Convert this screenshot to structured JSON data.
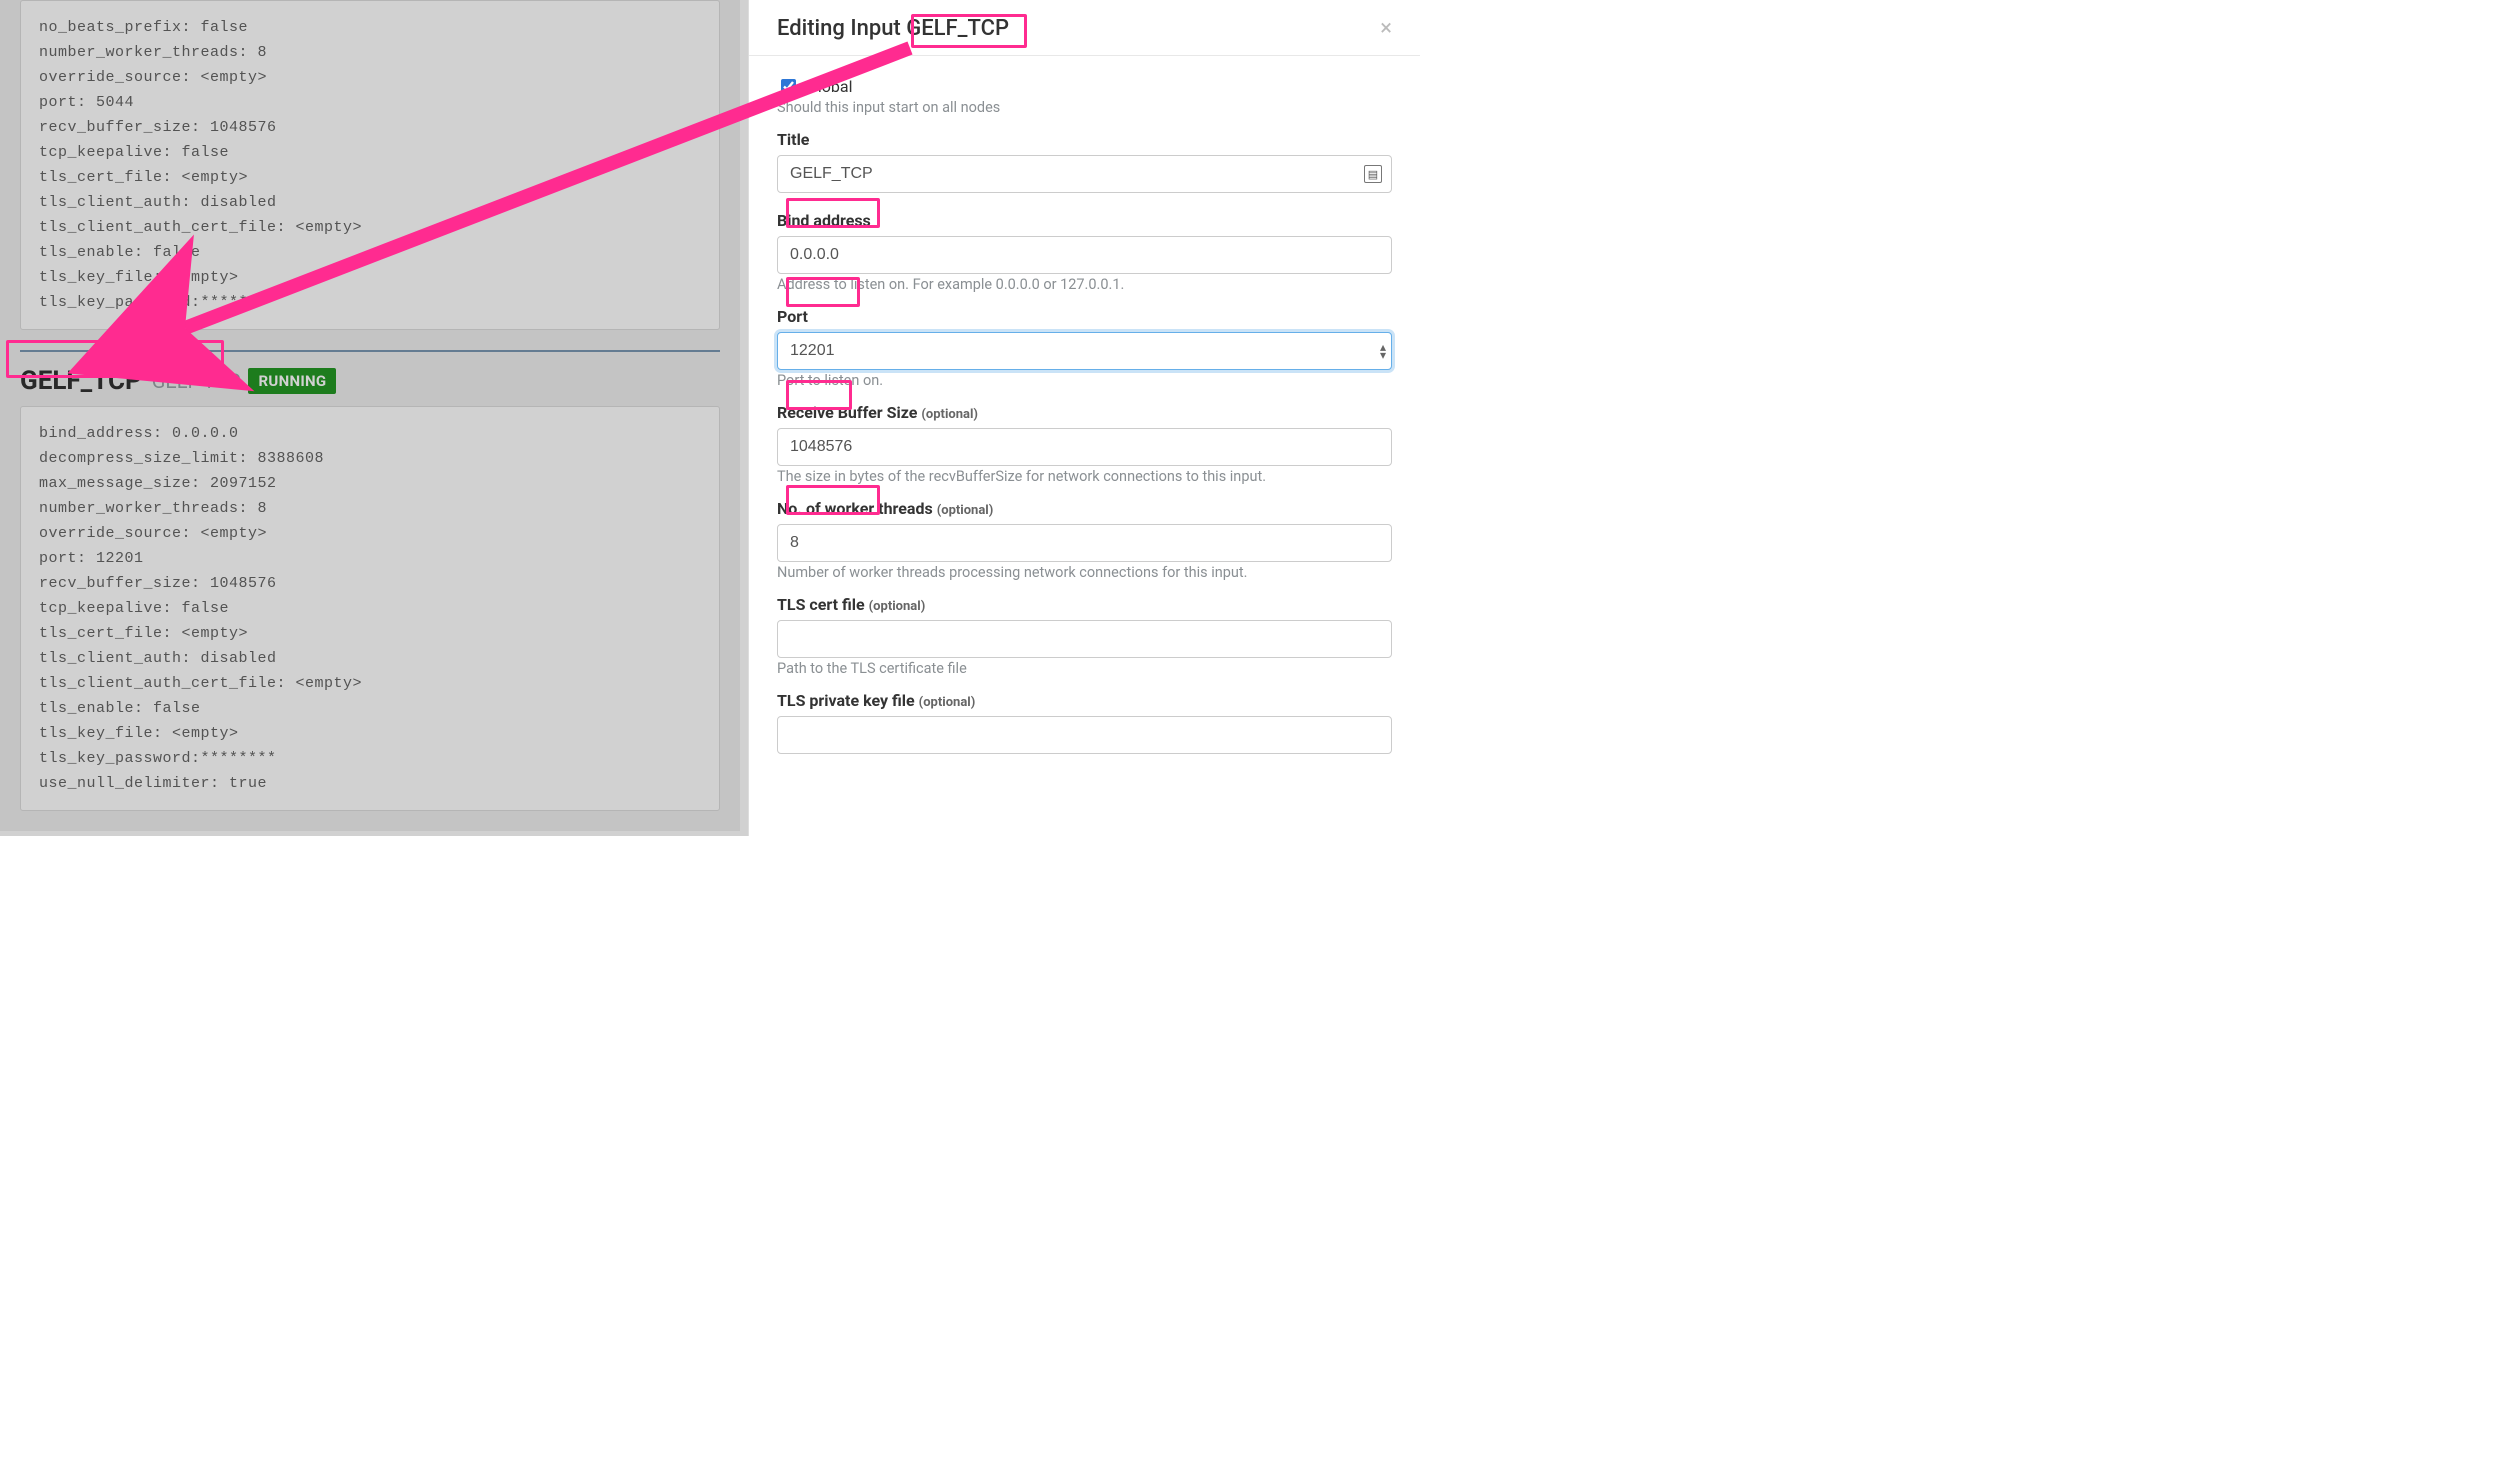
{
  "left": {
    "config_box_top": [
      "no_beats_prefix: false",
      "number_worker_threads: 8",
      "override_source: <empty>",
      "port: 5044",
      "recv_buffer_size: 1048576",
      "tcp_keepalive: false",
      "tls_cert_file: <empty>",
      "tls_client_auth: disabled",
      "tls_client_auth_cert_file: <empty>",
      "tls_enable: false",
      "tls_key_file: <empty>",
      "tls_key_password:********"
    ],
    "gelf": {
      "title": "GELF_TCP",
      "subtitle": "GELF TCP",
      "status": "RUNNING"
    },
    "config_box_bottom": [
      "bind_address: 0.0.0.0",
      "decompress_size_limit: 8388608",
      "max_message_size: 2097152",
      "number_worker_threads: 8",
      "override_source: <empty>",
      "port: 12201",
      "recv_buffer_size: 1048576",
      "tcp_keepalive: false",
      "tls_cert_file: <empty>",
      "tls_client_auth: disabled",
      "tls_client_auth_cert_file: <empty>",
      "tls_enable: false",
      "tls_key_file: <empty>",
      "tls_key_password:********",
      "use_null_delimiter: true"
    ]
  },
  "modal": {
    "title_prefix": "Editing Input ",
    "title_name": "GELF_TCP",
    "global_checked": true,
    "global_label": "Global",
    "global_help": "Should this input start on all nodes",
    "fields": {
      "title": {
        "label": "Title",
        "value": "GELF_TCP"
      },
      "bind_address": {
        "label": "Bind address",
        "value": "0.0.0.0",
        "help": "Address to listen on. For example 0.0.0.0 or 127.0.0.1."
      },
      "port": {
        "label": "Port",
        "value": "12201",
        "help": "Port to listen on."
      },
      "recv_buffer": {
        "label": "Receive Buffer Size",
        "optional": "(optional)",
        "value": "1048576",
        "help": "The size in bytes of the recvBufferSize for network connections to this input."
      },
      "worker_threads": {
        "label": "No. of worker threads",
        "optional": "(optional)",
        "value": "8",
        "help": "Number of worker threads processing network connections for this input."
      },
      "tls_cert": {
        "label": "TLS cert file",
        "optional": "(optional)",
        "value": "",
        "help": "Path to the TLS certificate file"
      },
      "tls_key": {
        "label": "TLS private key file",
        "optional": "(optional)",
        "value": ""
      }
    }
  }
}
